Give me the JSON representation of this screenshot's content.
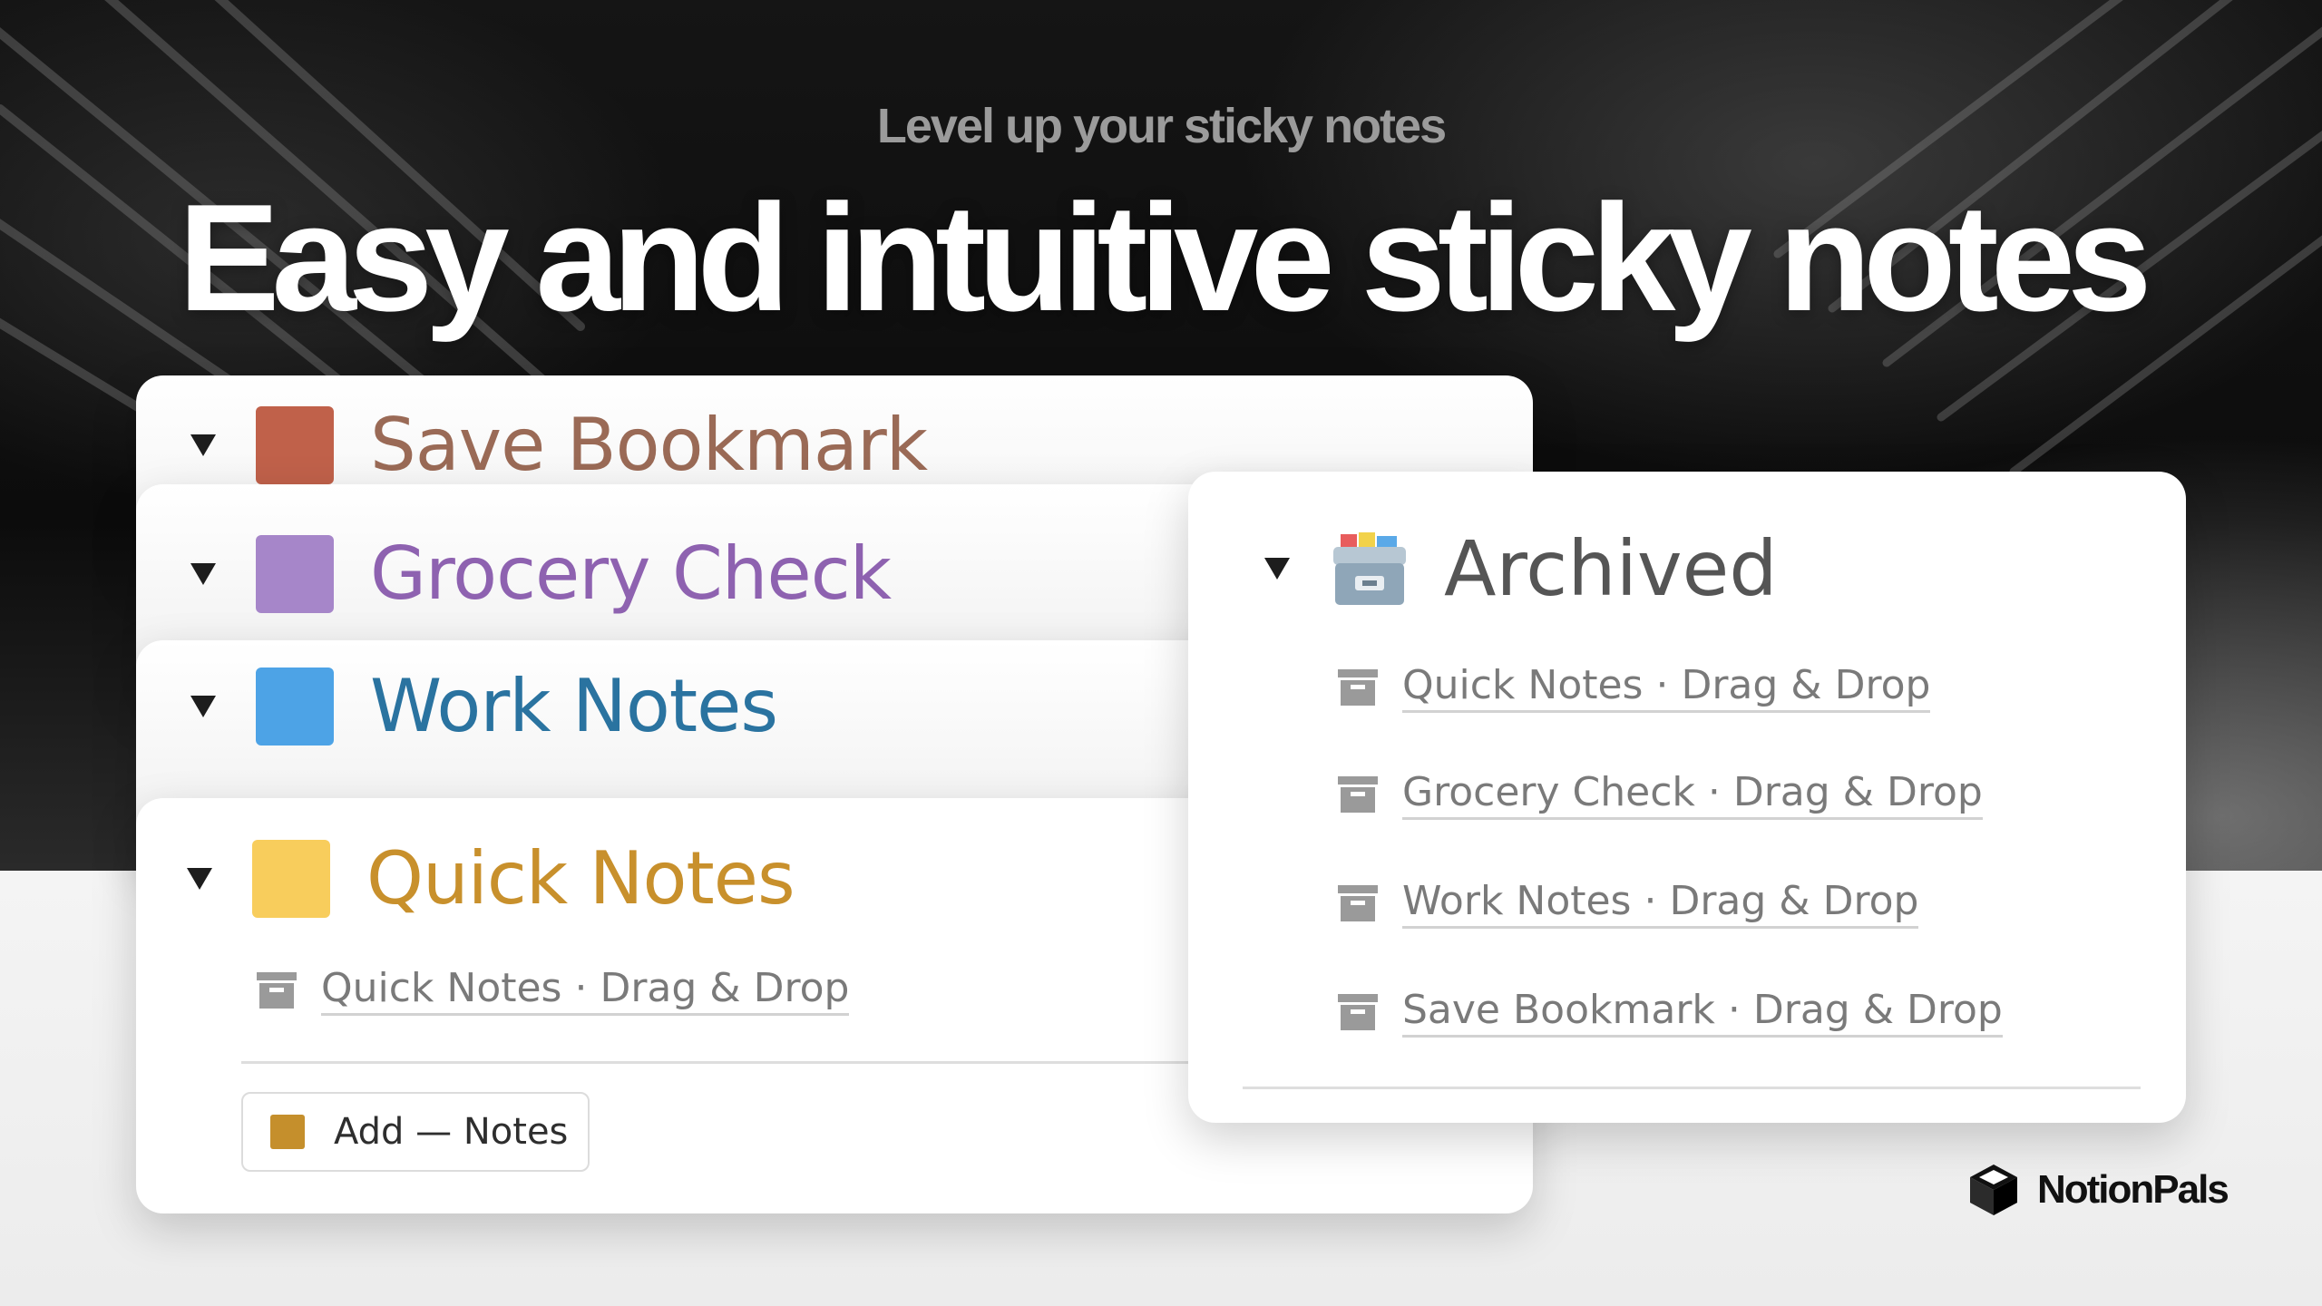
{
  "hero": {
    "subtitle": "Level up your sticky notes",
    "headline": "Easy and intuitive sticky notes"
  },
  "toggles": [
    {
      "label": "Save Bookmark",
      "swatch_color": "#c0614a",
      "text_color": "#9a6a56"
    },
    {
      "label": "Grocery Check",
      "swatch_color": "#a686c9",
      "text_color": "#8e62b0"
    },
    {
      "label": "Work Notes",
      "swatch_color": "#4da3e6",
      "text_color": "#2a73a0"
    },
    {
      "label": "Quick Notes",
      "swatch_color": "#f8cd5c",
      "text_color": "#c8902c"
    }
  ],
  "quick_notes": {
    "items": [
      "Quick Notes · Drag & Drop"
    ],
    "add_button_label": "Add — Notes"
  },
  "archived": {
    "title": "Archived",
    "icon": "card-file-box-icon",
    "items": [
      "Quick Notes · Drag & Drop",
      "Grocery Check · Drag & Drop",
      "Work Notes · Drag & Drop",
      "Save Bookmark · Drag & Drop"
    ]
  },
  "brand": {
    "name": "NotionPals",
    "icon": "cube-logo-icon"
  }
}
